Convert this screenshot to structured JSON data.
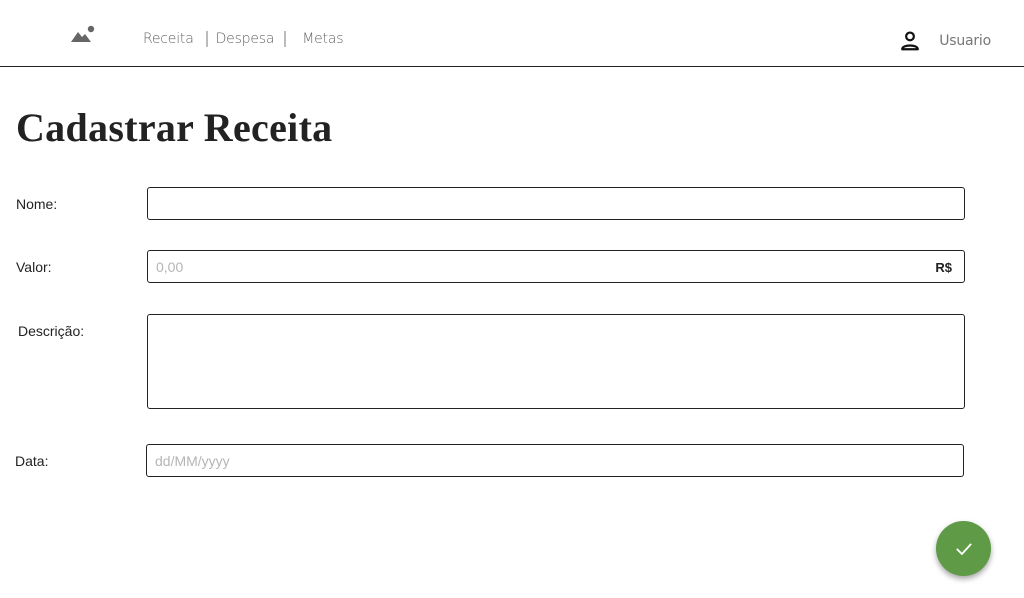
{
  "header": {
    "logo_icon": "mountain-sun-icon",
    "nav": {
      "receita": "Receita",
      "despesa": "Despesa",
      "metas": "Metas"
    },
    "user": {
      "icon": "user-icon",
      "label": "Usuario"
    }
  },
  "page": {
    "title": "Cadastrar Receita"
  },
  "form": {
    "nome": {
      "label": "Nome:",
      "value": "",
      "placeholder": ""
    },
    "valor": {
      "label": "Valor:",
      "value": "",
      "placeholder": "0,00",
      "currency": "R$"
    },
    "descricao": {
      "label": "Descrição:",
      "value": "",
      "placeholder": ""
    },
    "data": {
      "label": "Data:",
      "value": "",
      "placeholder": "dd/MM/yyyy"
    }
  },
  "actions": {
    "confirm_icon": "check-icon"
  },
  "colors": {
    "accent": "#5f9a47",
    "border": "#222222",
    "placeholder": "#b5b5b5",
    "nav_text": "#666666"
  }
}
